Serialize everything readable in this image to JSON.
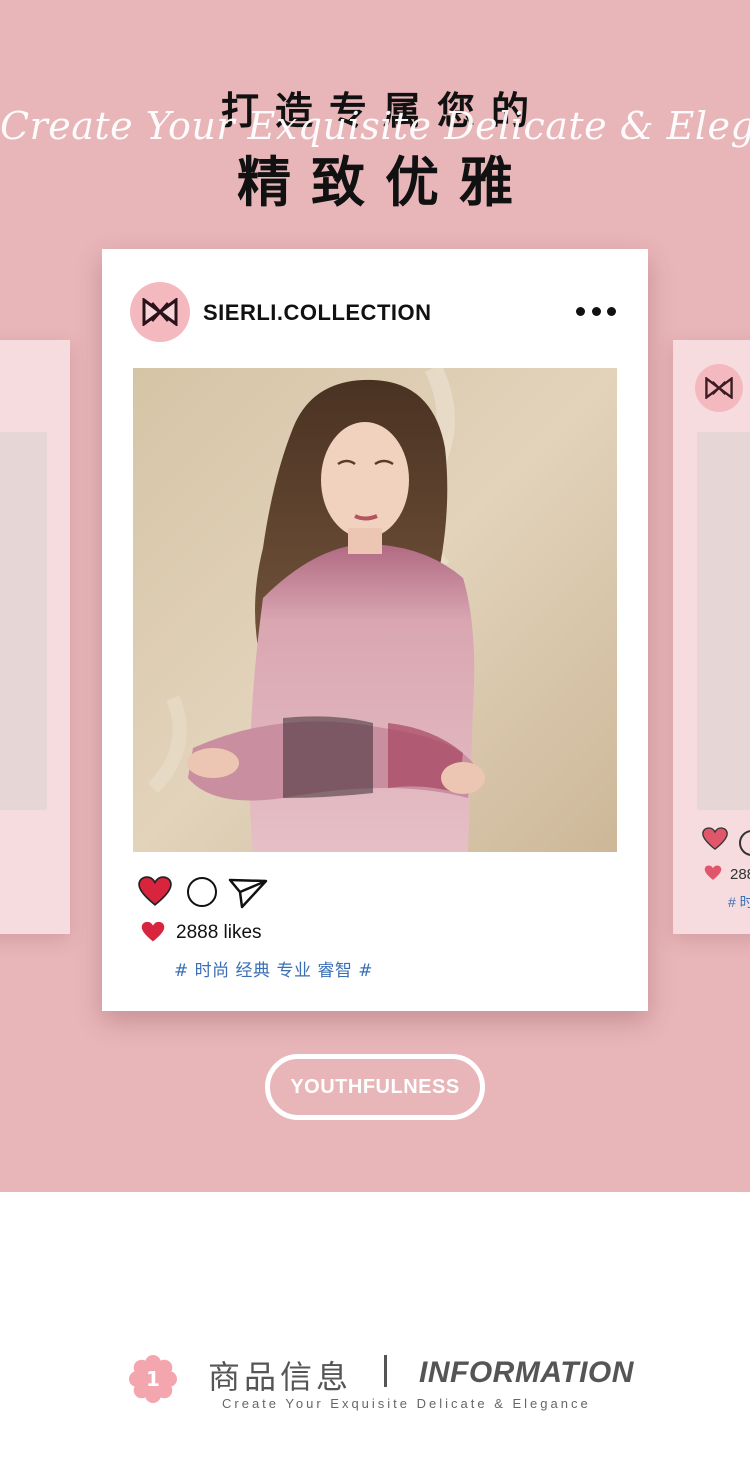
{
  "hero": {
    "script_text": "Create Your Exquisite Delicate & Elegance",
    "title_line1": "打造专属您的",
    "title_line2": "精致优雅"
  },
  "post": {
    "username": "SIERLI.COLLECTION",
    "likes": "2888 likes",
    "tags": "# 时尚 经典 专业 睿智 #"
  },
  "side_post": {
    "likes": "288",
    "tags": "# 时"
  },
  "badge": {
    "label": "YOUTHFULNESS"
  },
  "section": {
    "number": "1",
    "title_cn": "商品信息",
    "title_en": "INFORMATION",
    "subtitle": "Create Your Exquisite Delicate & Elegance"
  },
  "colors": {
    "background_pink": "#e8b5b8",
    "card_white": "#ffffff",
    "heart_red": "#d8243c",
    "tag_blue": "#3a6fb5",
    "avatar_pink": "#f3b9bf"
  },
  "icons": {
    "like": "heart-icon",
    "comment": "comment-icon",
    "share": "send-icon",
    "more": "more-dots-icon",
    "logo": "sierli-logo"
  }
}
